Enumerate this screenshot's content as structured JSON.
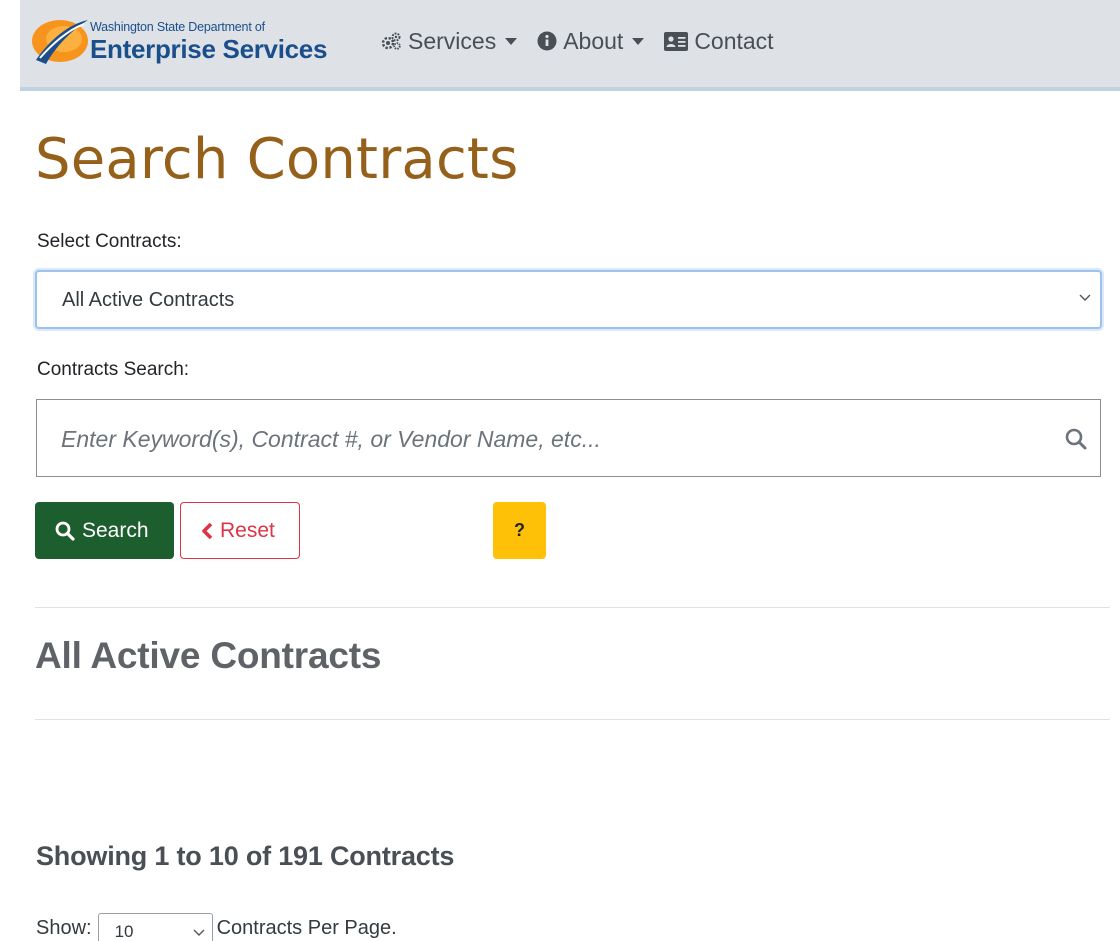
{
  "header": {
    "logo_small": "Washington State Department of",
    "logo_big": "Enterprise Services",
    "nav": {
      "services": "Services",
      "about": "About",
      "contact": "Contact"
    }
  },
  "main": {
    "title": "Search Contracts",
    "select_label": "Select Contracts:",
    "select_value": "All Active Contracts",
    "search_label": "Contracts Search:",
    "search_placeholder": "Enter Keyword(s), Contract #, or Vendor Name, etc...",
    "search_button": "Search",
    "reset_button": "Reset",
    "help_button": "?",
    "section_title": "All Active Contracts",
    "showing_text": "Showing 1 to 10 of 191 Contracts",
    "show_label": "Show:",
    "per_page_value": "10",
    "per_page_suffix": "Contracts Per Page."
  },
  "colors": {
    "title": "#95601a",
    "search_button": "#1d5e2f",
    "reset_button": "#dc3545",
    "help_button": "#ffc107",
    "navbar": "#dee2e6"
  },
  "icons": {
    "services": "cogs-icon",
    "about": "info-circle-icon",
    "contact": "address-card-icon",
    "search": "search-icon",
    "reset": "chevron-left-icon"
  }
}
